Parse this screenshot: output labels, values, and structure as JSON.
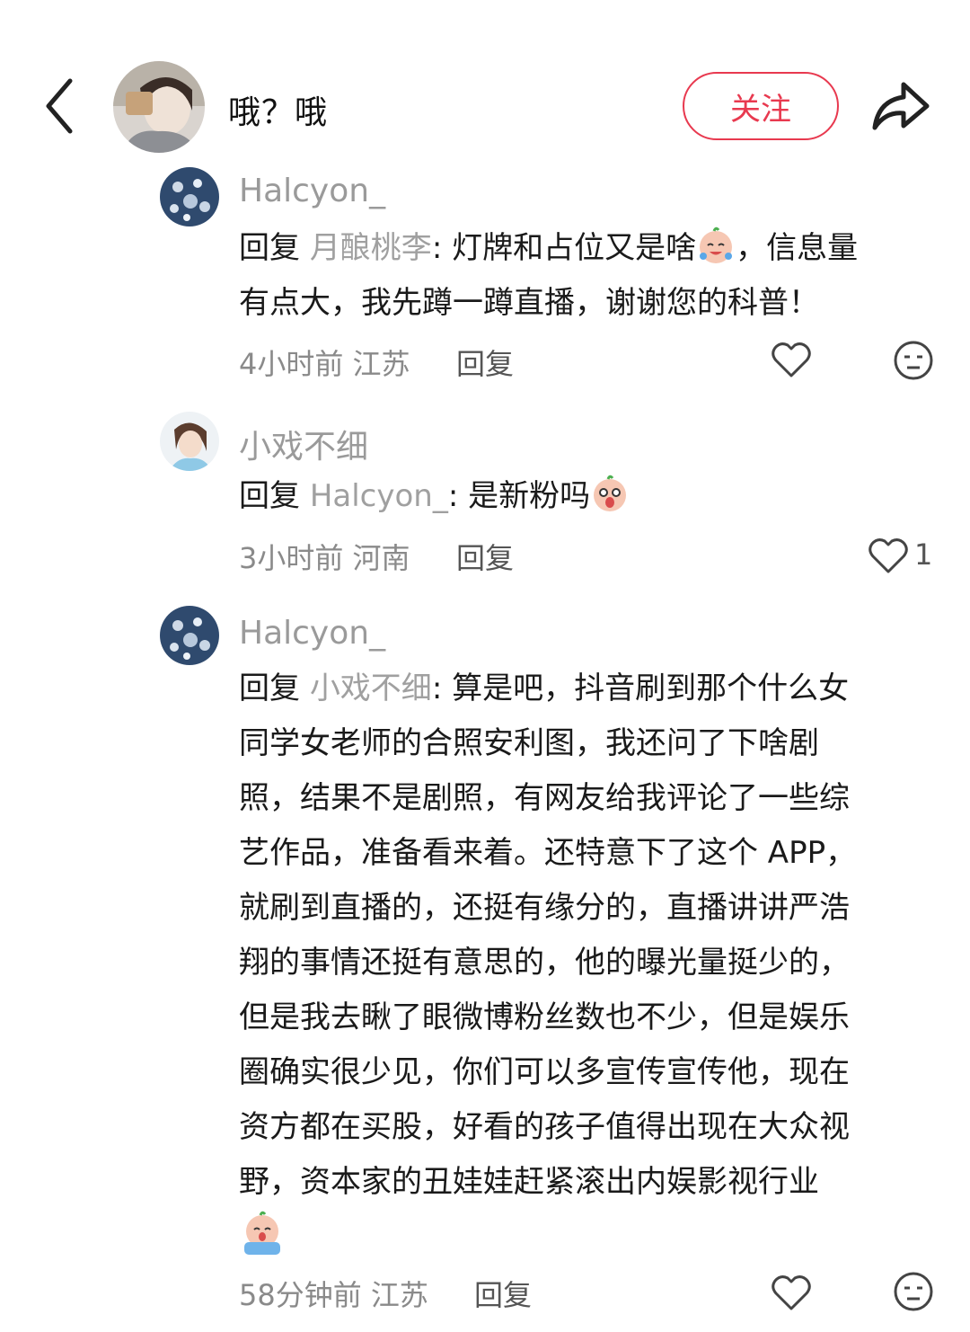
{
  "header": {
    "username": "哦？哦",
    "follow_label": "关注"
  },
  "comments": [
    {
      "username": "Halcyon_",
      "reply_prefix": "回复",
      "mention": "月酿桃李",
      "text_before_emoji": ": 灯牌和占位又是啥",
      "text_after_emoji": "，信息量有点大，我先蹲一蹲直播，谢谢您的科普！",
      "line1_after": "，信息量",
      "line2": "有点大，我先蹲一蹲直播，谢谢您的科普！",
      "time": "4小时前",
      "location": "江苏",
      "reply_label": "回复"
    },
    {
      "username": "小戏不细",
      "reply_prefix": "回复",
      "mention": "Halcyon_",
      "text_before_emoji": ": 是新粉吗",
      "time": "3小时前",
      "location": "河南",
      "reply_label": "回复",
      "like_count": "1"
    },
    {
      "username": "Halcyon_",
      "reply_prefix": "回复",
      "mention": "小戏不细",
      "line1_after": ": 算是吧，抖音刷到那个什么女",
      "lines": [
        "同学女老师的合照安利图，我还问了下啥剧",
        "照，结果不是剧照，有网友给我评论了一些综",
        "艺作品，准备看来着。还特意下了这个 APP，",
        "就刷到直播的，还挺有缘分的，直播讲讲严浩",
        "翔的事情还挺有意思的，他的曝光量挺少的，",
        "但是我去瞅了眼微博粉丝数也不少，但是娱乐",
        "圈确实很少见，你们可以多宣传宣传他，现在",
        "资方都在买股，好看的孩子值得出现在大众视",
        "野，资本家的丑娃娃赶紧滚出内娱影视行业"
      ],
      "time": "58分钟前",
      "location": "江苏",
      "reply_label": "回复"
    }
  ],
  "colors": {
    "accent": "#e8394f",
    "meta_gray": "#8a8a8a",
    "mention_gray": "#a0a0a0"
  }
}
